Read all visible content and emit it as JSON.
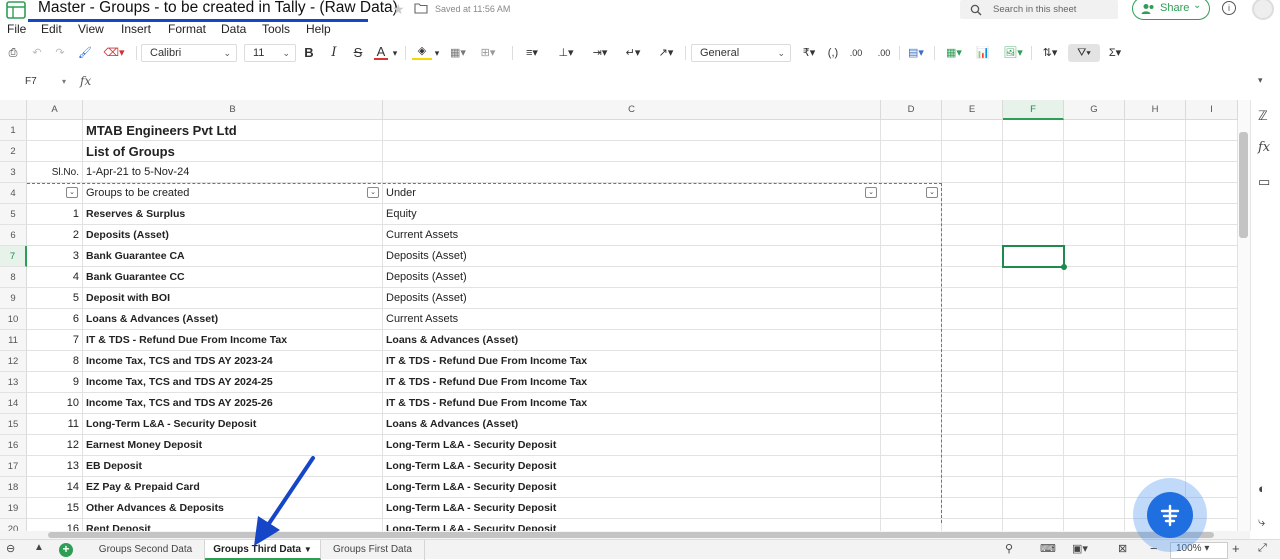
{
  "app": {
    "title": "Master  - Groups - to be created in Tally - (Raw Data)",
    "saved_status": "Saved at 11:56 AM",
    "search_placeholder": "Search in this sheet",
    "share_label": "Share"
  },
  "menu": [
    "File",
    "Edit",
    "View",
    "Insert",
    "Format",
    "Data",
    "Tools",
    "Help"
  ],
  "toolbar": {
    "font_name": "Calibri",
    "font_size": "11",
    "number_format": "General",
    "currency_symbol": "₹",
    "comma_label": "(,)",
    "dec_dec_label": ".00",
    "dec_inc_label": ".00",
    "bold_label": "B",
    "italic_label": "I",
    "strike_label": "S",
    "fontcolor_label": "A",
    "autosum_label": "Σ"
  },
  "formula_bar": {
    "cell_ref": "F7",
    "fx_label": "fx",
    "content": ""
  },
  "columns": [
    "A",
    "B",
    "C",
    "D",
    "E",
    "F",
    "G",
    "H",
    "I"
  ],
  "selected_column": "F",
  "selected_row": 7,
  "rows": [
    {
      "n": "1",
      "a": "",
      "b": "MTAB Engineers Pvt Ltd",
      "c": ""
    },
    {
      "n": "2",
      "a": "",
      "b": "List of Groups",
      "c": ""
    },
    {
      "n": "3",
      "a": "Sl.No.",
      "b": "1-Apr-21 to 5-Nov-24",
      "c": ""
    },
    {
      "n": "4",
      "a": "",
      "b": "Groups to be created",
      "c": "Under"
    },
    {
      "n": "5",
      "a": "1",
      "b": "Reserves & Surplus",
      "c": "Equity"
    },
    {
      "n": "6",
      "a": "2",
      "b": "Deposits (Asset)",
      "c": "Current Assets"
    },
    {
      "n": "7",
      "a": "3",
      "b": "Bank Guarantee CA",
      "c": "Deposits (Asset)"
    },
    {
      "n": "8",
      "a": "4",
      "b": "Bank Guarantee CC",
      "c": "Deposits (Asset)"
    },
    {
      "n": "9",
      "a": "5",
      "b": "Deposit with BOI",
      "c": "Deposits (Asset)"
    },
    {
      "n": "10",
      "a": "6",
      "b": "Loans & Advances (Asset)",
      "c": "Current Assets"
    },
    {
      "n": "11",
      "a": "7",
      "b": "IT & TDS - Refund Due From Income Tax",
      "c": "Loans & Advances (Asset)"
    },
    {
      "n": "12",
      "a": "8",
      "b": "Income Tax, TCS and TDS AY 2023-24",
      "c": "IT & TDS - Refund Due From Income Tax"
    },
    {
      "n": "13",
      "a": "9",
      "b": "Income Tax, TCS and TDS AY 2024-25",
      "c": "IT & TDS - Refund Due From Income Tax"
    },
    {
      "n": "14",
      "a": "10",
      "b": "Income Tax, TCS and TDS AY 2025-26",
      "c": "IT & TDS - Refund Due From Income Tax"
    },
    {
      "n": "15",
      "a": "11",
      "b": "Long-Term L&A - Security Deposit",
      "c": "Loans & Advances (Asset)"
    },
    {
      "n": "16",
      "a": "12",
      "b": "Earnest Money Deposit",
      "c": "Long-Term L&A - Security Deposit"
    },
    {
      "n": "17",
      "a": "13",
      "b": "EB Deposit",
      "c": "Long-Term L&A - Security Deposit"
    },
    {
      "n": "18",
      "a": "14",
      "b": "EZ Pay & Prepaid Card",
      "c": "Long-Term L&A - Security Deposit"
    },
    {
      "n": "19",
      "a": "15",
      "b": "Other Advances & Deposits",
      "c": "Long-Term L&A - Security Deposit"
    },
    {
      "n": "20",
      "a": "16",
      "b": "Rent Deposit",
      "c": "Long-Term L&A - Security Deposit"
    }
  ],
  "sheet_tabs": [
    {
      "label": "Groups Second Data",
      "active": false
    },
    {
      "label": "Groups Third Data",
      "active": true
    },
    {
      "label": "Groups First Data",
      "active": false
    }
  ],
  "zoom": "100%",
  "colors": {
    "accent": "#2f9e55",
    "annotation": "#1646c8",
    "fab": "#1f6fe0"
  }
}
